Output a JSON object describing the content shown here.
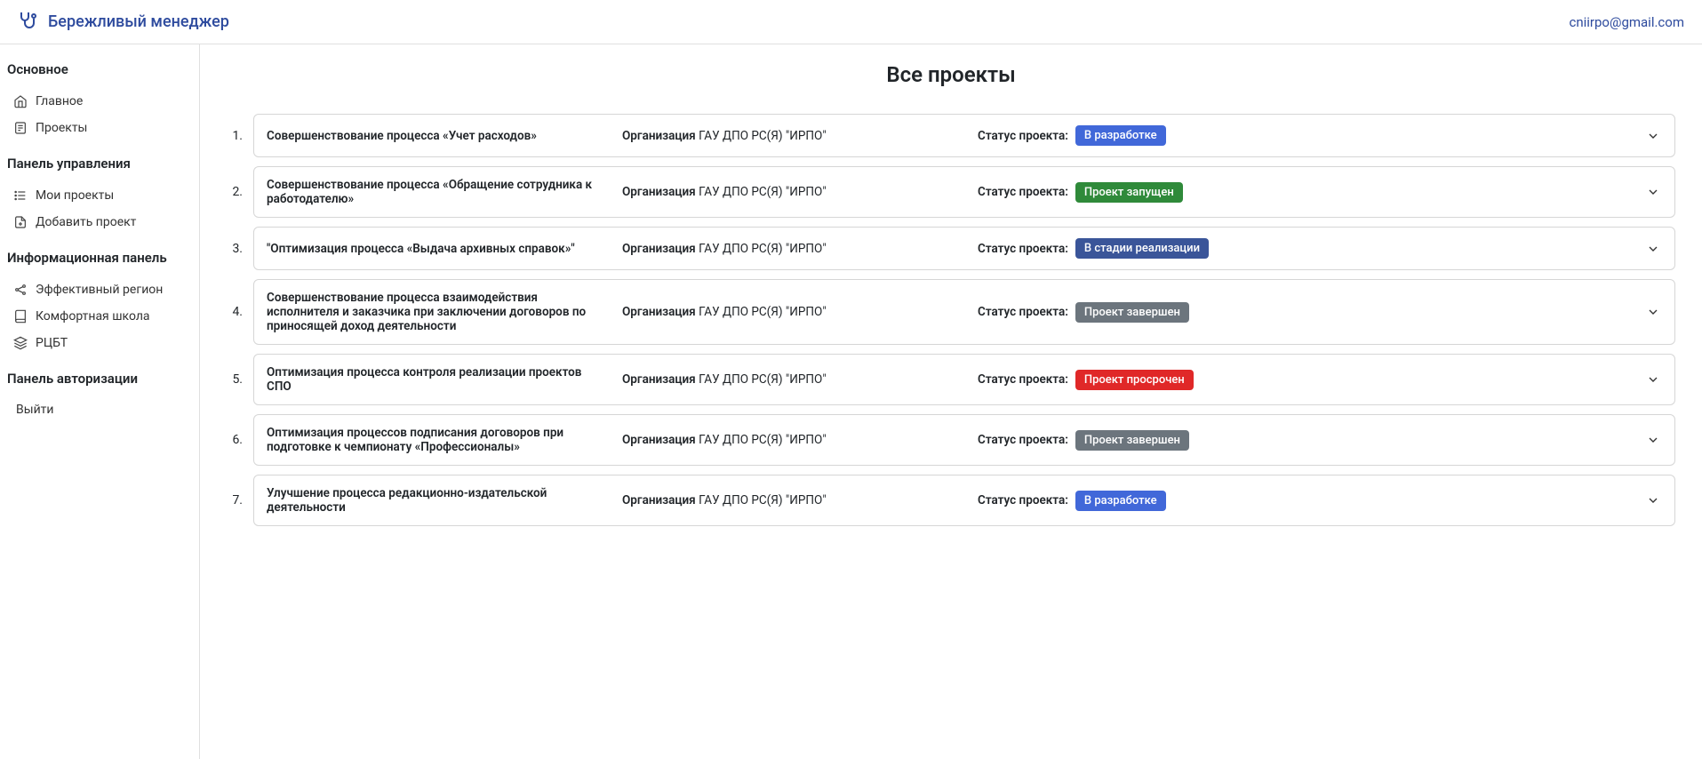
{
  "header": {
    "brand": "Бережливый менеджер",
    "user_email": "cniirpo@gmail.com"
  },
  "sidebar": {
    "sections": [
      {
        "title": "Основное",
        "items": [
          {
            "label": "Главное",
            "icon": "home-icon"
          },
          {
            "label": "Проекты",
            "icon": "document-icon"
          }
        ]
      },
      {
        "title": "Панель управления",
        "items": [
          {
            "label": "Мои проекты",
            "icon": "list-icon"
          },
          {
            "label": "Добавить проект",
            "icon": "file-plus-icon"
          }
        ]
      },
      {
        "title": "Информационная панель",
        "items": [
          {
            "label": "Эффективный регион",
            "icon": "share-icon"
          },
          {
            "label": "Комфортная школа",
            "icon": "book-icon"
          },
          {
            "label": "РЦБТ",
            "icon": "layers-icon"
          }
        ]
      },
      {
        "title": "Панель авторизации",
        "items": [
          {
            "label": "Выйти",
            "icon": ""
          }
        ]
      }
    ]
  },
  "main": {
    "title": "Все проекты",
    "org_label": "Организация",
    "status_label": "Статус проекта:",
    "projects": [
      {
        "num": "1.",
        "name": "Совершенствование процесса «Учет расходов»",
        "org": "ГАУ ДПО РС(Я) \"ИРПО\"",
        "status": "В разработке",
        "status_class": "badge-blue"
      },
      {
        "num": "2.",
        "name": "Совершенствование процесса «Обращение сотрудника к работодателю»",
        "org": "ГАУ ДПО РС(Я) \"ИРПО\"",
        "status": "Проект запущен",
        "status_class": "badge-green"
      },
      {
        "num": "3.",
        "name": "\"Оптимизация процесса «Выдача архивных справок»\"",
        "org": "ГАУ ДПО РС(Я) \"ИРПО\"",
        "status": "В стадии реализации",
        "status_class": "badge-indigo"
      },
      {
        "num": "4.",
        "name": "Совершенствование процесса взаимодействия исполнителя и заказчика при заключении договоров по приносящей доход деятельности",
        "org": "ГАУ ДПО РС(Я) \"ИРПО\"",
        "status": "Проект завершен",
        "status_class": "badge-gray"
      },
      {
        "num": "5.",
        "name": "Оптимизация процесса контроля реализации проектов СПО",
        "org": "ГАУ ДПО РС(Я) \"ИРПО\"",
        "status": "Проект просрочен",
        "status_class": "badge-red"
      },
      {
        "num": "6.",
        "name": "Оптимизация процессов подписания договоров при подготовке к чемпионату «Профессионалы»",
        "org": "ГАУ ДПО РС(Я) \"ИРПО\"",
        "status": "Проект завершен",
        "status_class": "badge-gray"
      },
      {
        "num": "7.",
        "name": "Улучшение процесса редакционно-издательской деятельности",
        "org": "ГАУ ДПО РС(Я) \"ИРПО\"",
        "status": "В разработке",
        "status_class": "badge-blue"
      }
    ]
  }
}
